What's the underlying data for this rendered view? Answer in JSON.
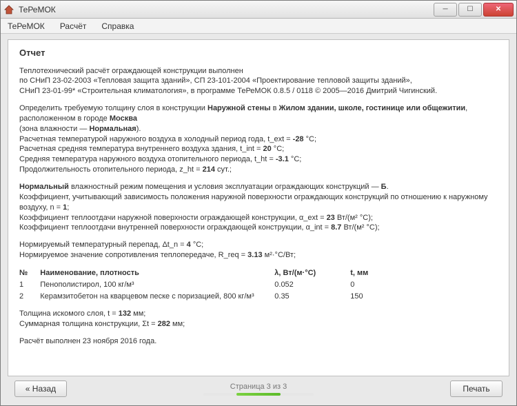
{
  "titlebar": {
    "title": "ТеРеМОК"
  },
  "menus": {
    "m1": "ТеРеМОК",
    "m2": "Расчёт",
    "m3": "Справка"
  },
  "report": {
    "heading": "Отчет",
    "p1": "Теплотехнический расчёт ограждающей конструкции выполнен\nпо СНиП 23-02-2003 «Тепловая защита зданий», СП 23-101-2004 «Проектирование тепловой защиты зданий»,\nСНиП 23-01-99* «Строительная климатология», в программе ТеРеМОК 0.8.5 / 0118 © 2005—2016 Дмитрий Чигинский.",
    "p2_pre": "Определить требуемую толщину слоя в конструкции ",
    "p2_b1": "Наружной стены",
    "p2_mid1": " в ",
    "p2_b2": "Жилом здании, школе, гостинице или общежитии",
    "p2_mid2": ", расположенном в городе ",
    "p2_b3": "Москва",
    "p2_line2_pre": "(зона влажности — ",
    "p2_line2_b": "Нормальная",
    "p2_line2_post": ").",
    "p2_l3_a": "Расчетная температурой наружного воздуха в холодный период года, t_ext = ",
    "p2_l3_v": "-28",
    "p2_l3_b": " °С;",
    "p2_l4_a": "Расчетная средняя температура внутреннего воздуха здания, t_int = ",
    "p2_l4_v": "20",
    "p2_l4_b": " °С;",
    "p2_l5_a": "Средняя температура наружного воздуха отопительного периода, t_ht = ",
    "p2_l5_v": "-3.1",
    "p2_l5_b": " °С;",
    "p2_l6_a": "Продолжительность отопительного периода, z_ht = ",
    "p2_l6_v": "214",
    "p2_l6_b": " сут.;",
    "p3_b1": "Нормальный",
    "p3_a": " влажностный режим помещения и условия эксплуатации ограждающих конструкций — ",
    "p3_b2": "Б",
    "p3_dot": ".",
    "p3_l2_a": "Коэффициент, учитывающий зависимость положения наружной поверхности ограждающих конструкций по отношению к наружному воздуху, n = ",
    "p3_l2_v": "1",
    "p3_l2_b": ";",
    "p3_l3_a": "Коэффициент теплоотдачи наружной поверхности ограждающей конструкции, α_ext = ",
    "p3_l3_v": "23",
    "p3_l3_b": " Вт/(м² °С);",
    "p3_l4_a": "Коэффициент теплоотдачи внутренней поверхности ограждающей конструкции, α_int = ",
    "p3_l4_v": "8.7",
    "p3_l4_b": " Вт/(м² °С);",
    "p4_l1_a": "Нормируемый температурный перепад, Δt_n = ",
    "p4_l1_v": "4",
    "p4_l1_b": " °С;",
    "p4_l2_a": "Нормируемое значение сопротивления теплопередаче, R_req = ",
    "p4_l2_v": "3.13",
    "p4_l2_b": " м²·°С/Вт;",
    "th_num": "№",
    "th_name": "Наименование, плотность",
    "th_lambda": "λ, Вт/(м·°С)",
    "th_t": "t, мм",
    "r1_n": "1",
    "r1_name": "Пенополистирол, 100 кг/м³",
    "r1_l": "0.052",
    "r1_t": "0",
    "r2_n": "2",
    "r2_name": "Керамзитобетон на кварцевом песке с поризацией, 800 кг/м³",
    "r2_l": "0.35",
    "r2_t": "150",
    "p5_l1_a": "Толщина искомого слоя, t = ",
    "p5_l1_v": "132",
    "p5_l1_b": " мм;",
    "p5_l2_a": "Суммарная толщина конструкции, Σt = ",
    "p5_l2_v": "282",
    "p5_l2_b": " мм;",
    "p6": "Расчёт выполнен 23 ноября 2016 года."
  },
  "footer": {
    "back": "« Назад",
    "page": "Страница 3 из 3",
    "print": "Печать"
  }
}
